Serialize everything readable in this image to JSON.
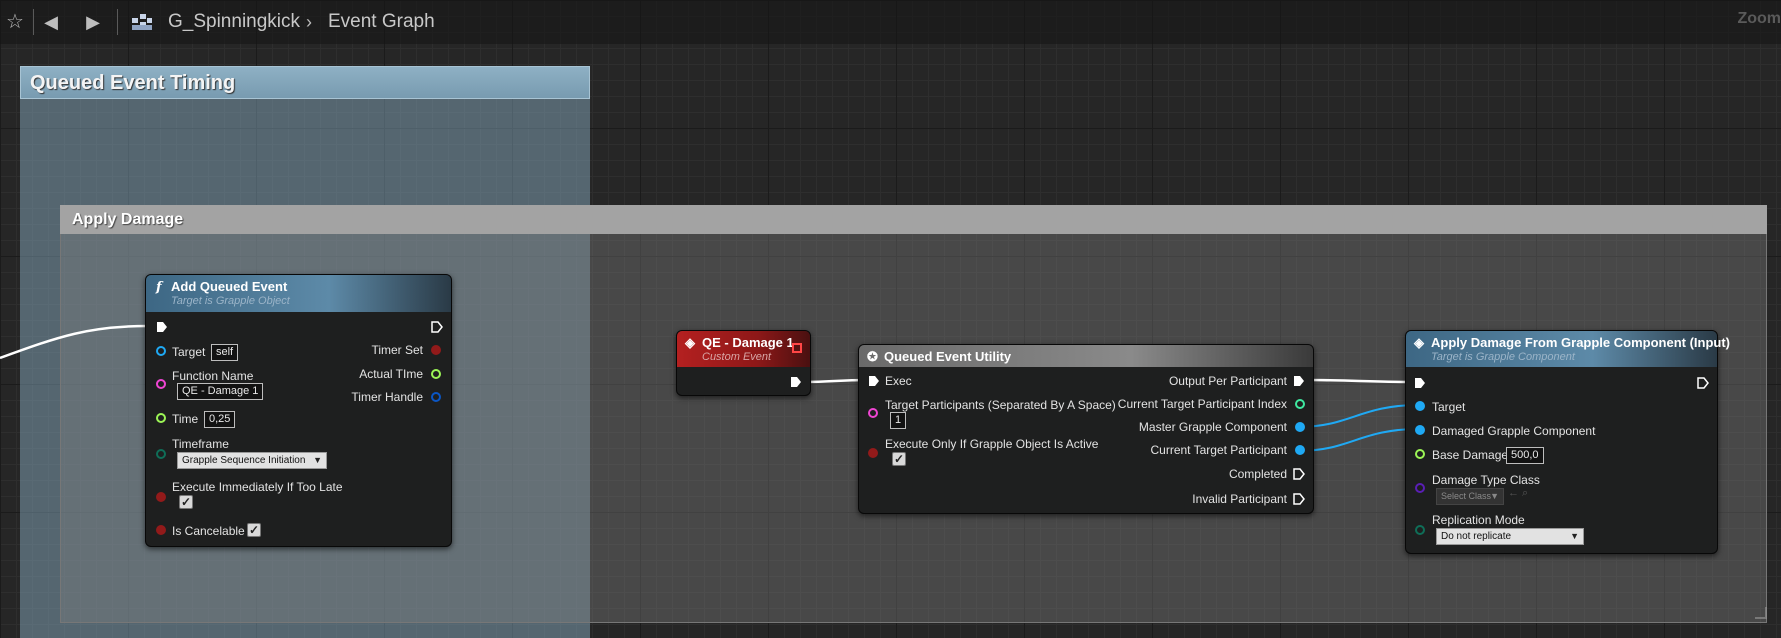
{
  "toolbar": {
    "breadcrumb_asset": "G_Spinningkick",
    "breadcrumb_graph": "Event Graph",
    "zoom_label": "Zoom"
  },
  "comments": {
    "outer_title": "Queued Event Timing",
    "inner_title": "Apply Damage"
  },
  "nodes": {
    "add_queued_event": {
      "title": "Add Queued Event",
      "subtitle": "Target is Grapple Object",
      "inputs": {
        "target_label": "Target",
        "target_value": "self",
        "function_name_label": "Function Name",
        "function_name_value": "QE - Damage 1",
        "time_label": "Time",
        "time_value": "0,25",
        "timeframe_label": "Timeframe",
        "timeframe_value": "Grapple Sequence Initiation",
        "execute_immediately_label": "Execute Immediately If Too Late",
        "is_cancelable_label": "Is Cancelable"
      },
      "outputs": {
        "timer_set": "Timer Set",
        "actual_time": "Actual TIme",
        "timer_handle": "Timer Handle"
      }
    },
    "qe_damage_1": {
      "title": "QE - Damage 1",
      "subtitle": "Custom Event"
    },
    "queued_event_utility": {
      "title": "Queued Event Utility",
      "inputs": {
        "exec": "Exec",
        "target_participants_label": "Target Participants (Separated By A Space)",
        "target_participants_value": "1",
        "execute_only_label": "Execute Only If Grapple Object Is Active"
      },
      "outputs": {
        "output_per_participant": "Output Per Participant",
        "current_target_participant_index": "Current Target Participant Index",
        "master_grapple_component": "Master Grapple Component",
        "current_target_participant": "Current Target Participant",
        "completed": "Completed",
        "invalid_participant": "Invalid Participant"
      }
    },
    "apply_damage": {
      "title": "Apply Damage From Grapple Component (Input)",
      "subtitle": "Target is Grapple Component",
      "inputs": {
        "target": "Target",
        "damaged_grapple_component": "Damaged Grapple Component",
        "base_damage_label": "Base Damage",
        "base_damage_value": "500,0",
        "damage_type_class_label": "Damage Type Class",
        "damage_type_class_value": "Select Class",
        "replication_mode_label": "Replication Mode",
        "replication_mode_value": "Do not replicate"
      }
    }
  },
  "colors": {
    "exec_pin": "#ffffff",
    "object_pin": "#1fa9f4",
    "string_pin": "#f045d3",
    "float_pin": "#9cf556",
    "int_pin": "#3fe8a0",
    "bool_pin": "#921a1a",
    "byte_pin": "#0f6e58",
    "struct_pin": "#0b56c4",
    "class_pin": "#5a1fb5",
    "event_node_head": "#8e1818",
    "function_node_head": "#4f7a96"
  },
  "icons": [
    "star-icon",
    "back-arrow-icon",
    "forward-arrow-icon",
    "blueprint-icon",
    "chevron-right-icon",
    "function-icon",
    "event-icon",
    "macro-icon"
  ]
}
